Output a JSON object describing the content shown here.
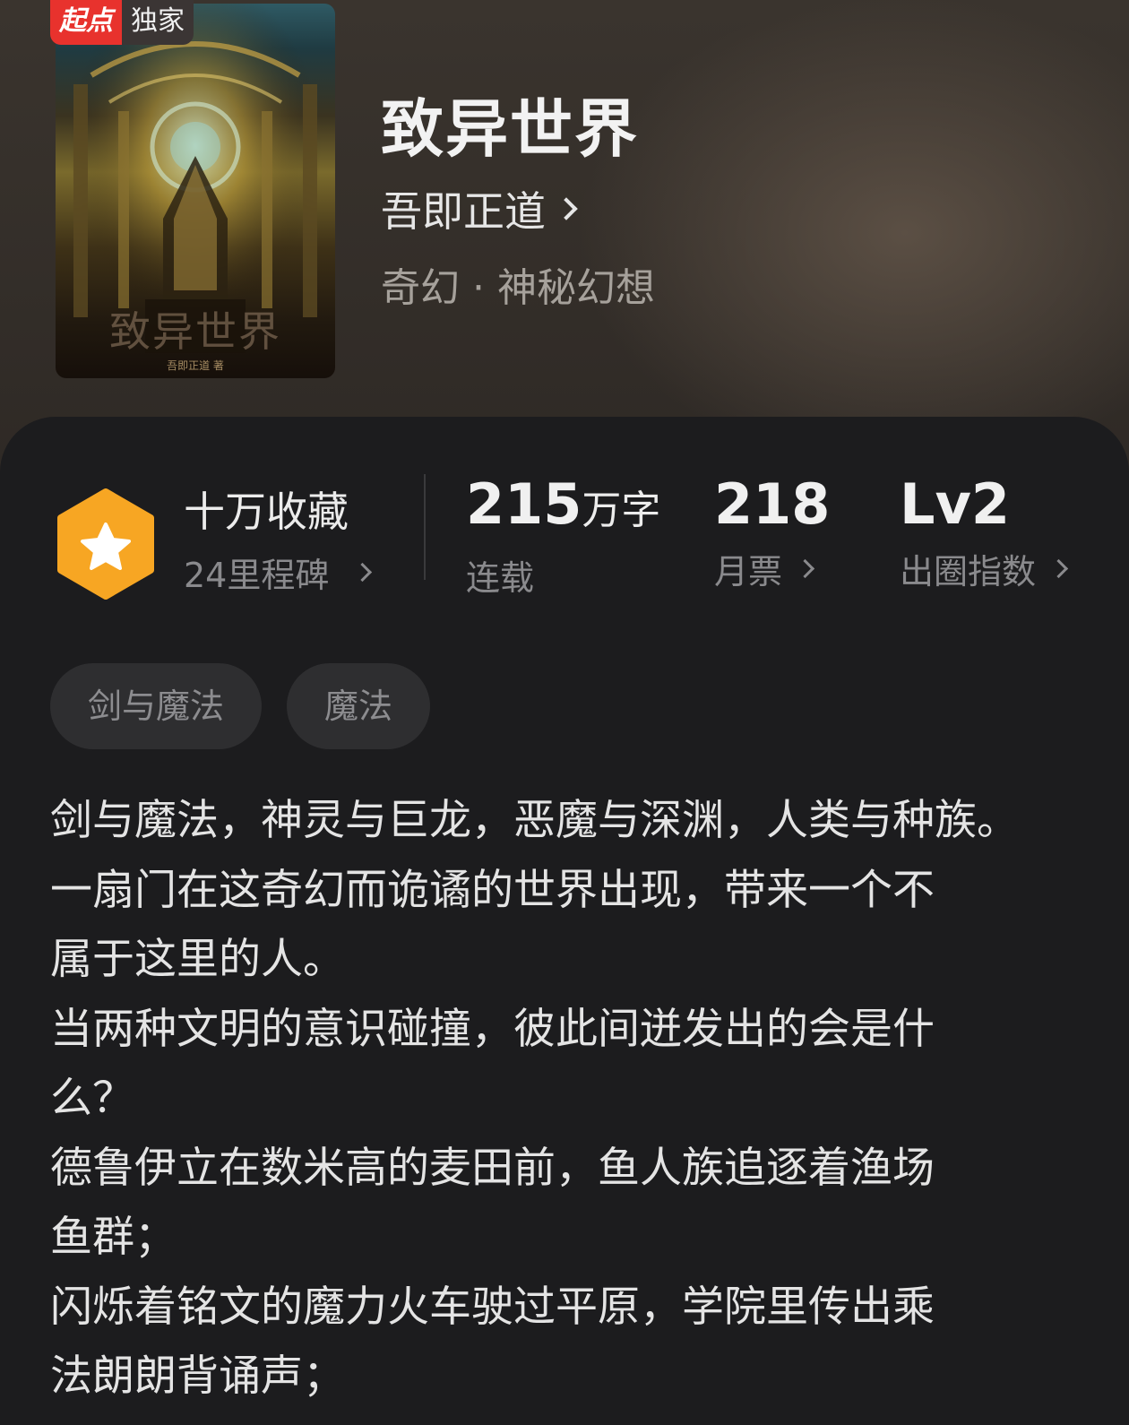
{
  "badge": {
    "brand": "起点",
    "exclusive": "独家"
  },
  "cover": {
    "title_art": "致异世界",
    "author_art": "吾即正道 著"
  },
  "book": {
    "title": "致异世界",
    "author": "吾即正道",
    "genre": "奇幻 · 神秘幻想"
  },
  "stats": {
    "collect_main": "十万收藏",
    "collect_sub": "24里程碑",
    "words_value": "215",
    "words_unit": "万字",
    "words_label": "连载",
    "tickets_value": "218",
    "tickets_label": "月票",
    "level_value": "Lv2",
    "level_label": "出圈指数"
  },
  "tags": [
    "剑与魔法",
    "魔法"
  ],
  "synopsis": [
    "剑与魔法，神灵与巨龙，恶魔与深渊，人类与种族。",
    "一扇门在这奇幻而诡谲的世界出现，带来一个不",
    "属于这里的人。",
    "当两种文明的意识碰撞，彼此间迸发出的会是什",
    "么？",
    "德鲁伊立在数米高的麦田前，鱼人族追逐着渔场",
    "鱼群；",
    "闪烁着铭文的魔力火车驶过平原，学院里传出乘",
    "法朗朗背诵声；"
  ],
  "colors": {
    "badge_red": "#e8322d",
    "medal_orange": "#f7a623",
    "card_bg": "#1c1c1e"
  },
  "icons": {
    "medal": "star-hexagon-icon",
    "chevron": "chevron-right-icon"
  }
}
